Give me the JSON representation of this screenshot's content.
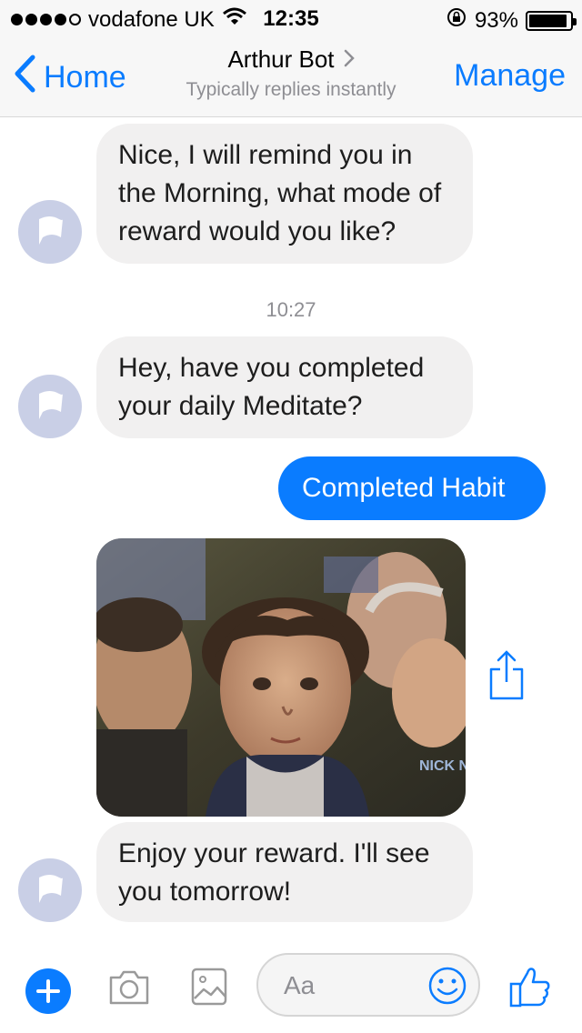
{
  "status_bar": {
    "carrier": "vodafone UK",
    "time": "12:35",
    "battery": "93%",
    "battery_level": 0.93,
    "signal_dots_filled": 4,
    "signal_dots_total": 5,
    "icons": [
      "wifi-icon",
      "rotation-lock-icon",
      "battery-icon"
    ]
  },
  "nav": {
    "back_label": "Home",
    "title": "Arthur Bot",
    "subtitle": "Typically replies instantly",
    "manage_label": "Manage"
  },
  "messages": [
    {
      "sender": "bot",
      "text": "Nice, I will remind you in the Morning, what mode of reward would you like?"
    },
    {
      "sender": "timestamp",
      "text": "10:27"
    },
    {
      "sender": "bot",
      "text": "Hey, have you completed your daily Meditate?"
    },
    {
      "sender": "user",
      "text": "Completed Habit"
    },
    {
      "sender": "bot",
      "type": "gif",
      "watermark": "NICK NITE",
      "share_icon": "share-icon"
    },
    {
      "sender": "bot",
      "text": "Enjoy your reward. I'll see you tomorrow!"
    }
  ],
  "compose": {
    "placeholder": "Aa",
    "icons": [
      "plus-icon",
      "camera-icon",
      "gallery-icon",
      "emoji-icon",
      "thumbs-up-icon"
    ]
  },
  "colors": {
    "accent": "#0a7cff",
    "incoming_bubble": "#f1f0f0",
    "avatar": "#c9cfe6",
    "secondary_text": "#8e8e93"
  }
}
